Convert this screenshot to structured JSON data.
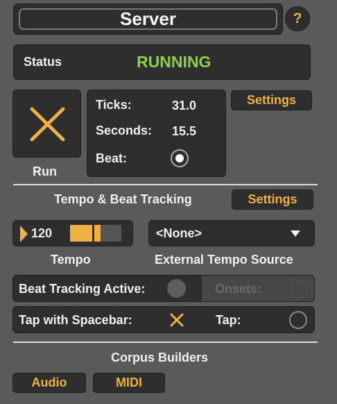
{
  "header": {
    "title": "Server",
    "help_icon": "?"
  },
  "status": {
    "label": "Status",
    "value": "RUNNING",
    "value_color": "#8fce4a"
  },
  "transport": {
    "run_label": "Run",
    "run_icon": "x-icon",
    "ticks_label": "Ticks:",
    "ticks_value": "31.0",
    "seconds_label": "Seconds:",
    "seconds_value": "15.5",
    "beat_label": "Beat:",
    "settings_label": "Settings"
  },
  "tempo_section": {
    "title": "Tempo & Beat Tracking",
    "settings_label": "Settings",
    "tempo_value": "120",
    "tempo_label": "Tempo",
    "tempo_slider_fraction": 0.6,
    "external_source_value": "<None>",
    "external_source_label": "External Tempo Source",
    "beat_tracking_label": "Beat Tracking Active:",
    "onsets_label": "Onsets:",
    "tap_spacebar_label": "Tap with Spacebar:",
    "tap_label": "Tap:"
  },
  "corpus": {
    "title": "Corpus Builders",
    "audio_label": "Audio",
    "midi_label": "MIDI"
  },
  "colors": {
    "accent": "#f0b142",
    "panel": "#2e2e2e",
    "background": "#5a5a5a"
  }
}
